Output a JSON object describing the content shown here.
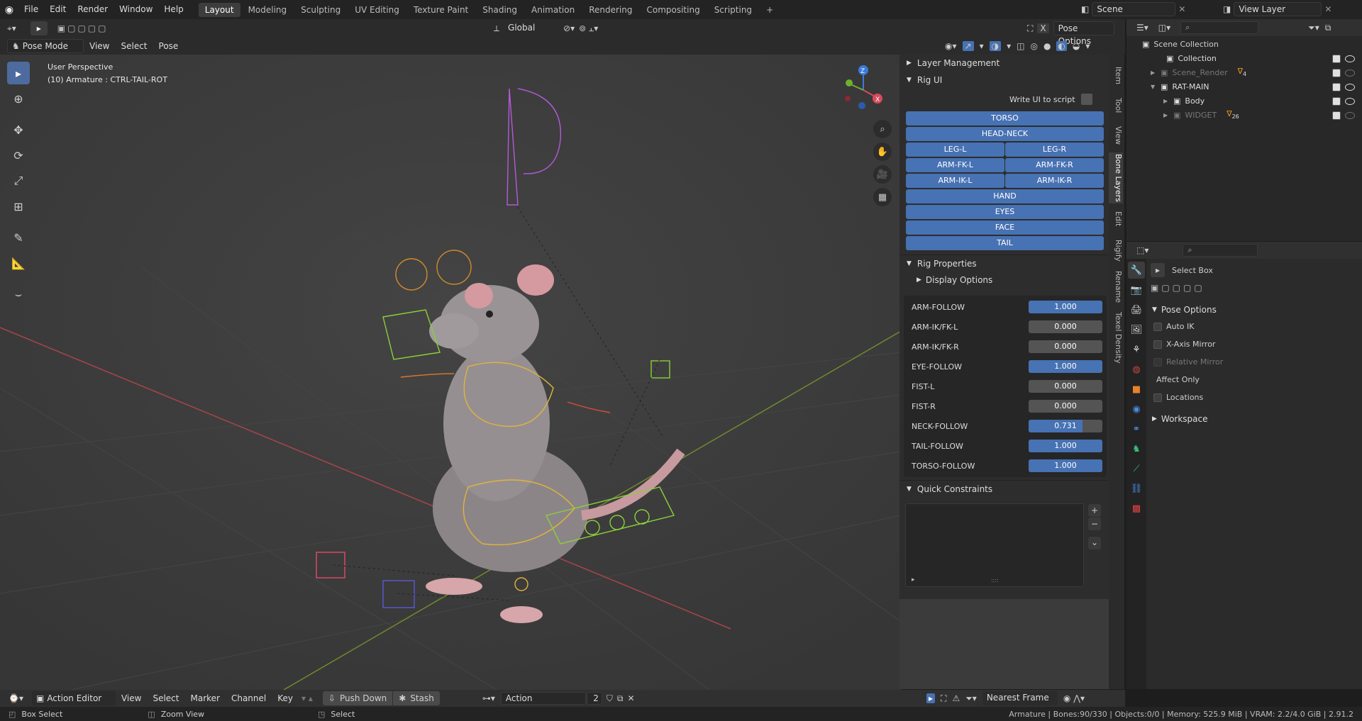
{
  "app": {
    "name": "Blender"
  },
  "menu": [
    "File",
    "Edit",
    "Render",
    "Window",
    "Help"
  ],
  "workspaces": [
    "Layout",
    "Modeling",
    "Sculpting",
    "UV Editing",
    "Texture Paint",
    "Shading",
    "Animation",
    "Rendering",
    "Compositing",
    "Scripting"
  ],
  "active_workspace": "Layout",
  "add_workspace": "+",
  "scene": {
    "label": "Scene",
    "view_layer": "View Layer"
  },
  "viewport_header": {
    "mode": "Pose Mode",
    "menus": [
      "View",
      "Select",
      "Pose"
    ],
    "transform_orientation": "Global",
    "pose_options": "Pose Options",
    "close_x": "X"
  },
  "viewport": {
    "perspective": "User Perspective",
    "object_info": "(10) Armature : CTRL-TAIL-ROT",
    "gizmo": {
      "z": "Z",
      "x": "X",
      "y": "Y"
    }
  },
  "rig_panel": {
    "layer_management": "Layer Management",
    "rig_ui": "Rig UI",
    "write_ui": "Write UI to script",
    "buttons_full": [
      "TORSO",
      "HEAD-NECK"
    ],
    "buttons_pairs": [
      [
        "LEG-L",
        "LEG-R"
      ],
      [
        "ARM-FK-L",
        "ARM-FK-R"
      ],
      [
        "ARM-IK-L",
        "ARM-IK-R"
      ]
    ],
    "buttons_tail": [
      "HAND",
      "EYES",
      "FACE",
      "TAIL"
    ],
    "rig_properties": "Rig Properties",
    "display_options": "Display Options",
    "properties": [
      {
        "label": "ARM-FOLLOW",
        "value": "1.000",
        "fraction": 1.0
      },
      {
        "label": "ARM-IK/FK-L",
        "value": "0.000",
        "fraction": 0.0
      },
      {
        "label": "ARM-IK/FK-R",
        "value": "0.000",
        "fraction": 0.0
      },
      {
        "label": "EYE-FOLLOW",
        "value": "1.000",
        "fraction": 1.0
      },
      {
        "label": "FIST-L",
        "value": "0.000",
        "fraction": 0.0
      },
      {
        "label": "FIST-R",
        "value": "0.000",
        "fraction": 0.0
      },
      {
        "label": "NECK-FOLLOW",
        "value": "0.731",
        "fraction": 0.731
      },
      {
        "label": "TAIL-FOLLOW",
        "value": "1.000",
        "fraction": 1.0
      },
      {
        "label": "TORSO-FOLLOW",
        "value": "1.000",
        "fraction": 1.0
      }
    ],
    "quick_constraints": "Quick Constraints",
    "qc_add": "+",
    "qc_remove": "−",
    "qc_more": "⌄",
    "qc_expand": "▸",
    "qc_grip": "::::"
  },
  "sidebar_tabs": [
    "Item",
    "Tool",
    "View",
    "Bone Layers",
    "Edit",
    "Rigify",
    "Rename",
    "Texel Density"
  ],
  "active_sidebar_tab": "Bone Layers",
  "outliner": {
    "root": "Scene Collection",
    "items": [
      {
        "label": "Collection",
        "depth": 1,
        "disabled": false,
        "checked": true
      },
      {
        "label": "Scene_Render",
        "depth": 1,
        "disabled": true,
        "checked": true,
        "badge": "4"
      },
      {
        "label": "RAT-MAIN",
        "depth": 1,
        "disabled": false,
        "checked": true
      },
      {
        "label": "Body",
        "depth": 2,
        "disabled": false,
        "checked": true
      },
      {
        "label": "WIDGET",
        "depth": 2,
        "disabled": true,
        "checked": true,
        "badge": "26"
      }
    ]
  },
  "properties_editor": {
    "tool": "Select Box",
    "pose_options": "Pose Options",
    "auto_ik": "Auto IK",
    "x_axis_mirror": "X-Axis Mirror",
    "relative_mirror": "Relative Mirror",
    "affect_only": "Affect Only",
    "locations": "Locations",
    "workspace": "Workspace"
  },
  "timeline": {
    "editor": "Action Editor",
    "menus": [
      "View",
      "Select",
      "Marker",
      "Channel",
      "Key"
    ],
    "push_down": "Push Down",
    "stash": "Stash",
    "action_label": "Action",
    "action_users": "2",
    "snap": "Nearest Frame"
  },
  "statusbar": {
    "left1": "Box Select",
    "left2": "Zoom View",
    "left3": "Select",
    "right": "Armature | Bones:90/330 | Objects:0/0 | Memory: 525.9 MiB | VRAM: 2.2/4.0 GiB | 2.91.2"
  },
  "colors": {
    "accent": "#4772b3",
    "header": "#303030",
    "viewport": "#3b3b3b"
  }
}
